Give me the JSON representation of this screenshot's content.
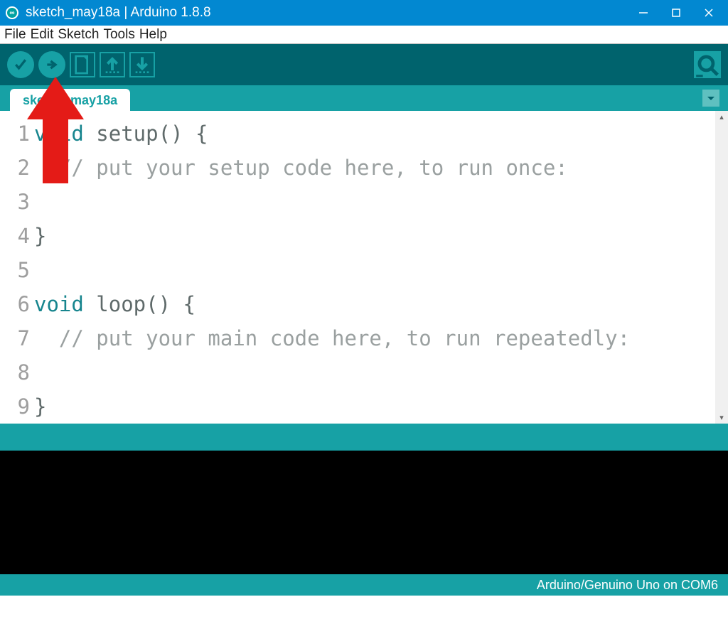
{
  "window": {
    "title": "sketch_may18a | Arduino 1.8.8"
  },
  "menu": {
    "file": "File",
    "edit": "Edit",
    "sketch": "Sketch",
    "tools": "Tools",
    "help": "Help"
  },
  "tab": {
    "label": "sketch_may18a"
  },
  "code": {
    "lines": [
      "1",
      "2",
      "3",
      "4",
      "5",
      "6",
      "7",
      "8",
      "9"
    ],
    "l1_kw": "void",
    "l1_rest": " setup() {",
    "l2": "  // put your setup code here, to run once:",
    "l3": "",
    "l4": "}",
    "l5": "",
    "l6_kw": "void",
    "l6_rest": " loop() {",
    "l7": "  // put your main code here, to run repeatedly:",
    "l8": "",
    "l9": "}"
  },
  "footer": {
    "board": "Arduino/Genuino Uno on COM6"
  }
}
